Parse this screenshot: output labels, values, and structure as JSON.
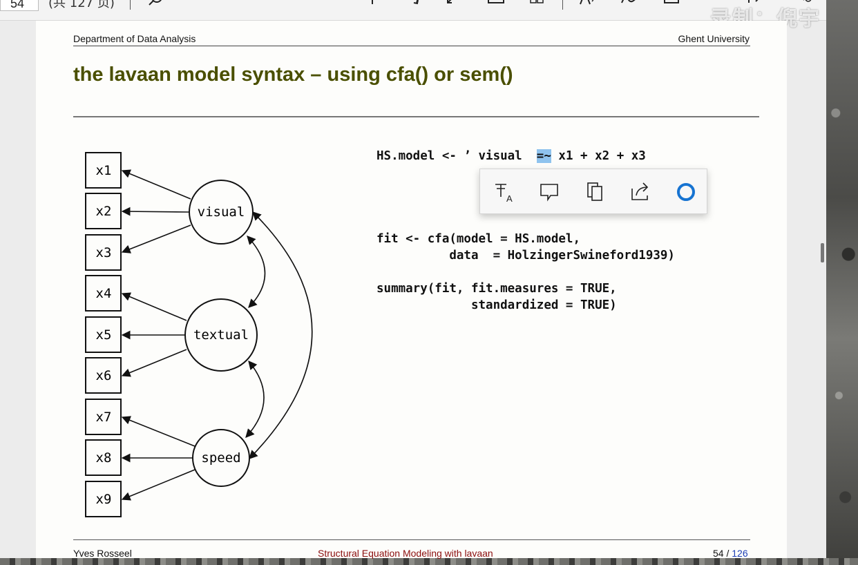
{
  "toolbar": {
    "page_number": "54",
    "page_total": "(共 127 页)",
    "icons": [
      "search-icon",
      "minus-icon",
      "plus-icon",
      "rotate-icon",
      "fit-width-icon",
      "fit-page-icon",
      "two-page-icon",
      "read-aloud-icon",
      "draw-icon",
      "erase-icon",
      "save-icon",
      "more-icon"
    ]
  },
  "watermark": "录制：倪宇",
  "slide": {
    "header_left": "Department of Data Analysis",
    "header_right": "Ghent University",
    "title": "the lavaan model syntax – using cfa() or sem()",
    "diagram": {
      "indicators": [
        "x1",
        "x2",
        "x3",
        "x4",
        "x5",
        "x6",
        "x7",
        "x8",
        "x9"
      ],
      "factors": [
        "visual",
        "textual",
        "speed"
      ]
    },
    "code": {
      "line1_pre": "HS.model <- ’ visual  ",
      "line1_sel": "=~",
      "line1_post": " x1 + x2 + x3",
      "line2": "fit <- cfa(model = HS.model,",
      "line3": "          data  = HolzingerSwineford1939)",
      "line4": "summary(fit, fit.measures = TRUE,",
      "line5": "             standardized = TRUE)"
    },
    "footer_left": "Yves Rosseel",
    "footer_center": "Structural Equation Modeling with lavaan",
    "footer_page": "54 /",
    "footer_total": "126"
  },
  "selection_popup": {
    "actions": [
      "highlight-text-icon",
      "comment-icon",
      "copy-icon",
      "share-icon",
      "cortana-icon"
    ]
  }
}
